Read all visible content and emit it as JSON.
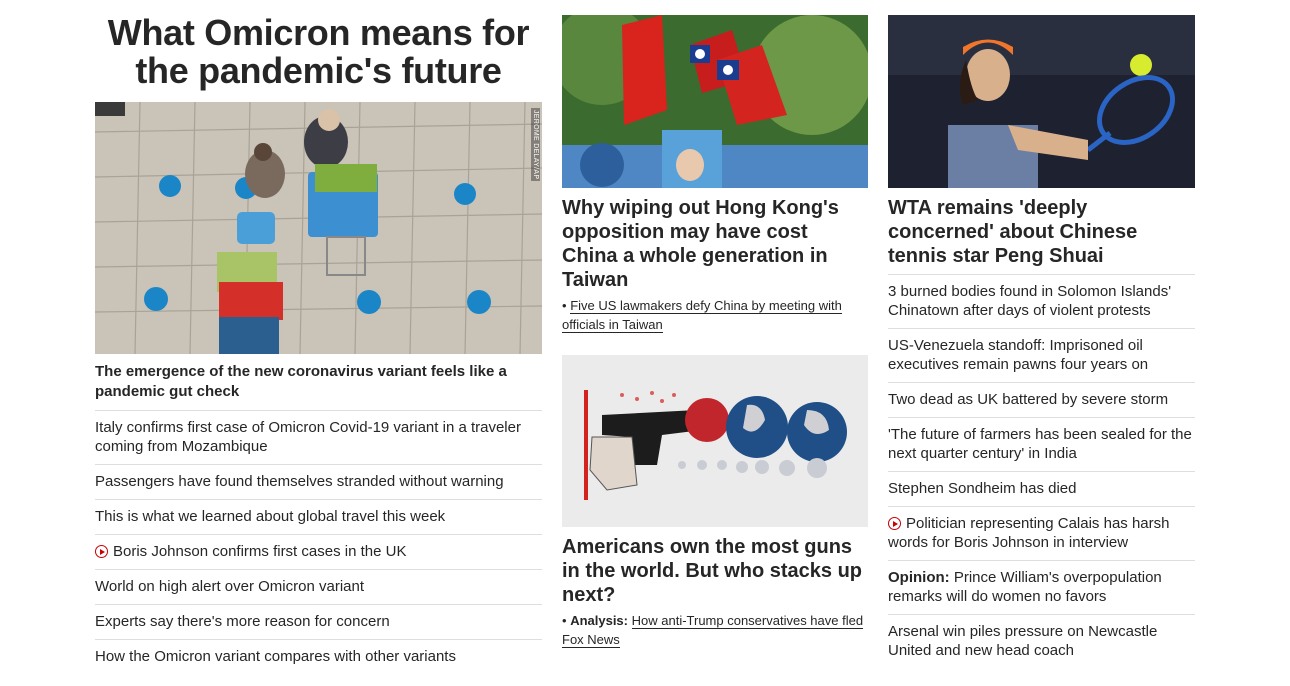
{
  "left": {
    "title": "What Omicron means for the pandemic's future",
    "photo_credit": "JEROME DELAY/AP",
    "lead": "The emergence of the new coronavirus variant feels like a pandemic gut check",
    "items": [
      {
        "text": "Italy confirms first case of Omicron Covid-19 variant in a traveler coming from Mozambique"
      },
      {
        "text": "Passengers have found themselves stranded without warning"
      },
      {
        "text": "This is what we learned about global travel this week"
      },
      {
        "text": "Boris Johnson confirms first cases in the UK",
        "icon": "play-icon"
      },
      {
        "text": "World on high alert over Omicron variant"
      },
      {
        "text": "Experts say there's more reason for concern"
      },
      {
        "text": "How the Omicron variant compares with other variants"
      }
    ]
  },
  "middle": {
    "story1": {
      "headline": "Why wiping out Hong Kong's opposition may have cost China a whole generation in Taiwan",
      "bullet": "•",
      "sub": "Five US lawmakers defy China by meeting with officials in Taiwan"
    },
    "story2": {
      "headline": "Americans own the most guns in the world. But who stacks up next?",
      "bullet": "•",
      "prefix": "Analysis:",
      "sub": "How anti-Trump conservatives have fled Fox News"
    }
  },
  "right": {
    "headline": "WTA remains 'deeply concerned' about Chinese tennis star Peng Shuai",
    "items": [
      {
        "text": "3 burned bodies found in Solomon Islands' Chinatown after days of violent protests"
      },
      {
        "text": "US-Venezuela standoff: Imprisoned oil executives remain pawns four years on"
      },
      {
        "text": "Two dead as UK battered by severe storm"
      },
      {
        "text": "'The future of farmers has been sealed for the next quarter century' in India"
      },
      {
        "text": "Stephen Sondheim has died"
      },
      {
        "text": "Politician representing Calais has harsh words for Boris Johnson in interview",
        "icon": "play-icon"
      },
      {
        "prefix": "Opinion:",
        "text": " Prince William's overpopulation remarks will do women no favors"
      },
      {
        "text": "Arsenal win piles pressure on Newcastle United and new head coach"
      }
    ]
  },
  "colors": {
    "text": "#262626",
    "divider": "#dedede",
    "video_red": "#cc0000"
  }
}
